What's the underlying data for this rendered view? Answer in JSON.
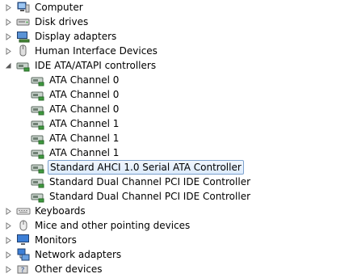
{
  "device_tree": {
    "items": [
      {
        "label": "Computer",
        "level": 0,
        "expanded": false,
        "icon": "computer-icon"
      },
      {
        "label": "Disk drives",
        "level": 0,
        "expanded": false,
        "icon": "disk-drive-icon"
      },
      {
        "label": "Display adapters",
        "level": 0,
        "expanded": false,
        "icon": "display-adapter-icon"
      },
      {
        "label": "Human Interface Devices",
        "level": 0,
        "expanded": false,
        "icon": "hid-icon"
      },
      {
        "label": "IDE ATA/ATAPI controllers",
        "level": 0,
        "expanded": true,
        "icon": "ide-controller-icon"
      },
      {
        "label": "ATA Channel 0",
        "level": 1,
        "icon": "ide-controller-icon"
      },
      {
        "label": "ATA Channel 0",
        "level": 1,
        "icon": "ide-controller-icon"
      },
      {
        "label": "ATA Channel 0",
        "level": 1,
        "icon": "ide-controller-icon"
      },
      {
        "label": "ATA Channel 1",
        "level": 1,
        "icon": "ide-controller-icon"
      },
      {
        "label": "ATA Channel 1",
        "level": 1,
        "icon": "ide-controller-icon"
      },
      {
        "label": "ATA Channel 1",
        "level": 1,
        "icon": "ide-controller-icon"
      },
      {
        "label": "Standard AHCI 1.0 Serial ATA Controller",
        "level": 1,
        "selected": true,
        "icon": "ide-controller-icon"
      },
      {
        "label": "Standard Dual Channel PCI IDE Controller",
        "level": 1,
        "icon": "ide-controller-icon"
      },
      {
        "label": "Standard Dual Channel PCI IDE Controller",
        "level": 1,
        "icon": "ide-controller-icon"
      },
      {
        "label": "Keyboards",
        "level": 0,
        "expanded": false,
        "icon": "keyboard-icon"
      },
      {
        "label": "Mice and other pointing devices",
        "level": 0,
        "expanded": false,
        "icon": "mouse-icon"
      },
      {
        "label": "Monitors",
        "level": 0,
        "expanded": false,
        "icon": "monitor-icon"
      },
      {
        "label": "Network adapters",
        "level": 0,
        "expanded": false,
        "icon": "network-adapter-icon"
      },
      {
        "label": "Other devices",
        "level": 0,
        "expanded": false,
        "icon": "other-devices-icon"
      }
    ]
  },
  "colors": {
    "selection_border": "#7da2ce",
    "selection_fill": "#dcebfc",
    "expander": "#7a7a7a"
  }
}
